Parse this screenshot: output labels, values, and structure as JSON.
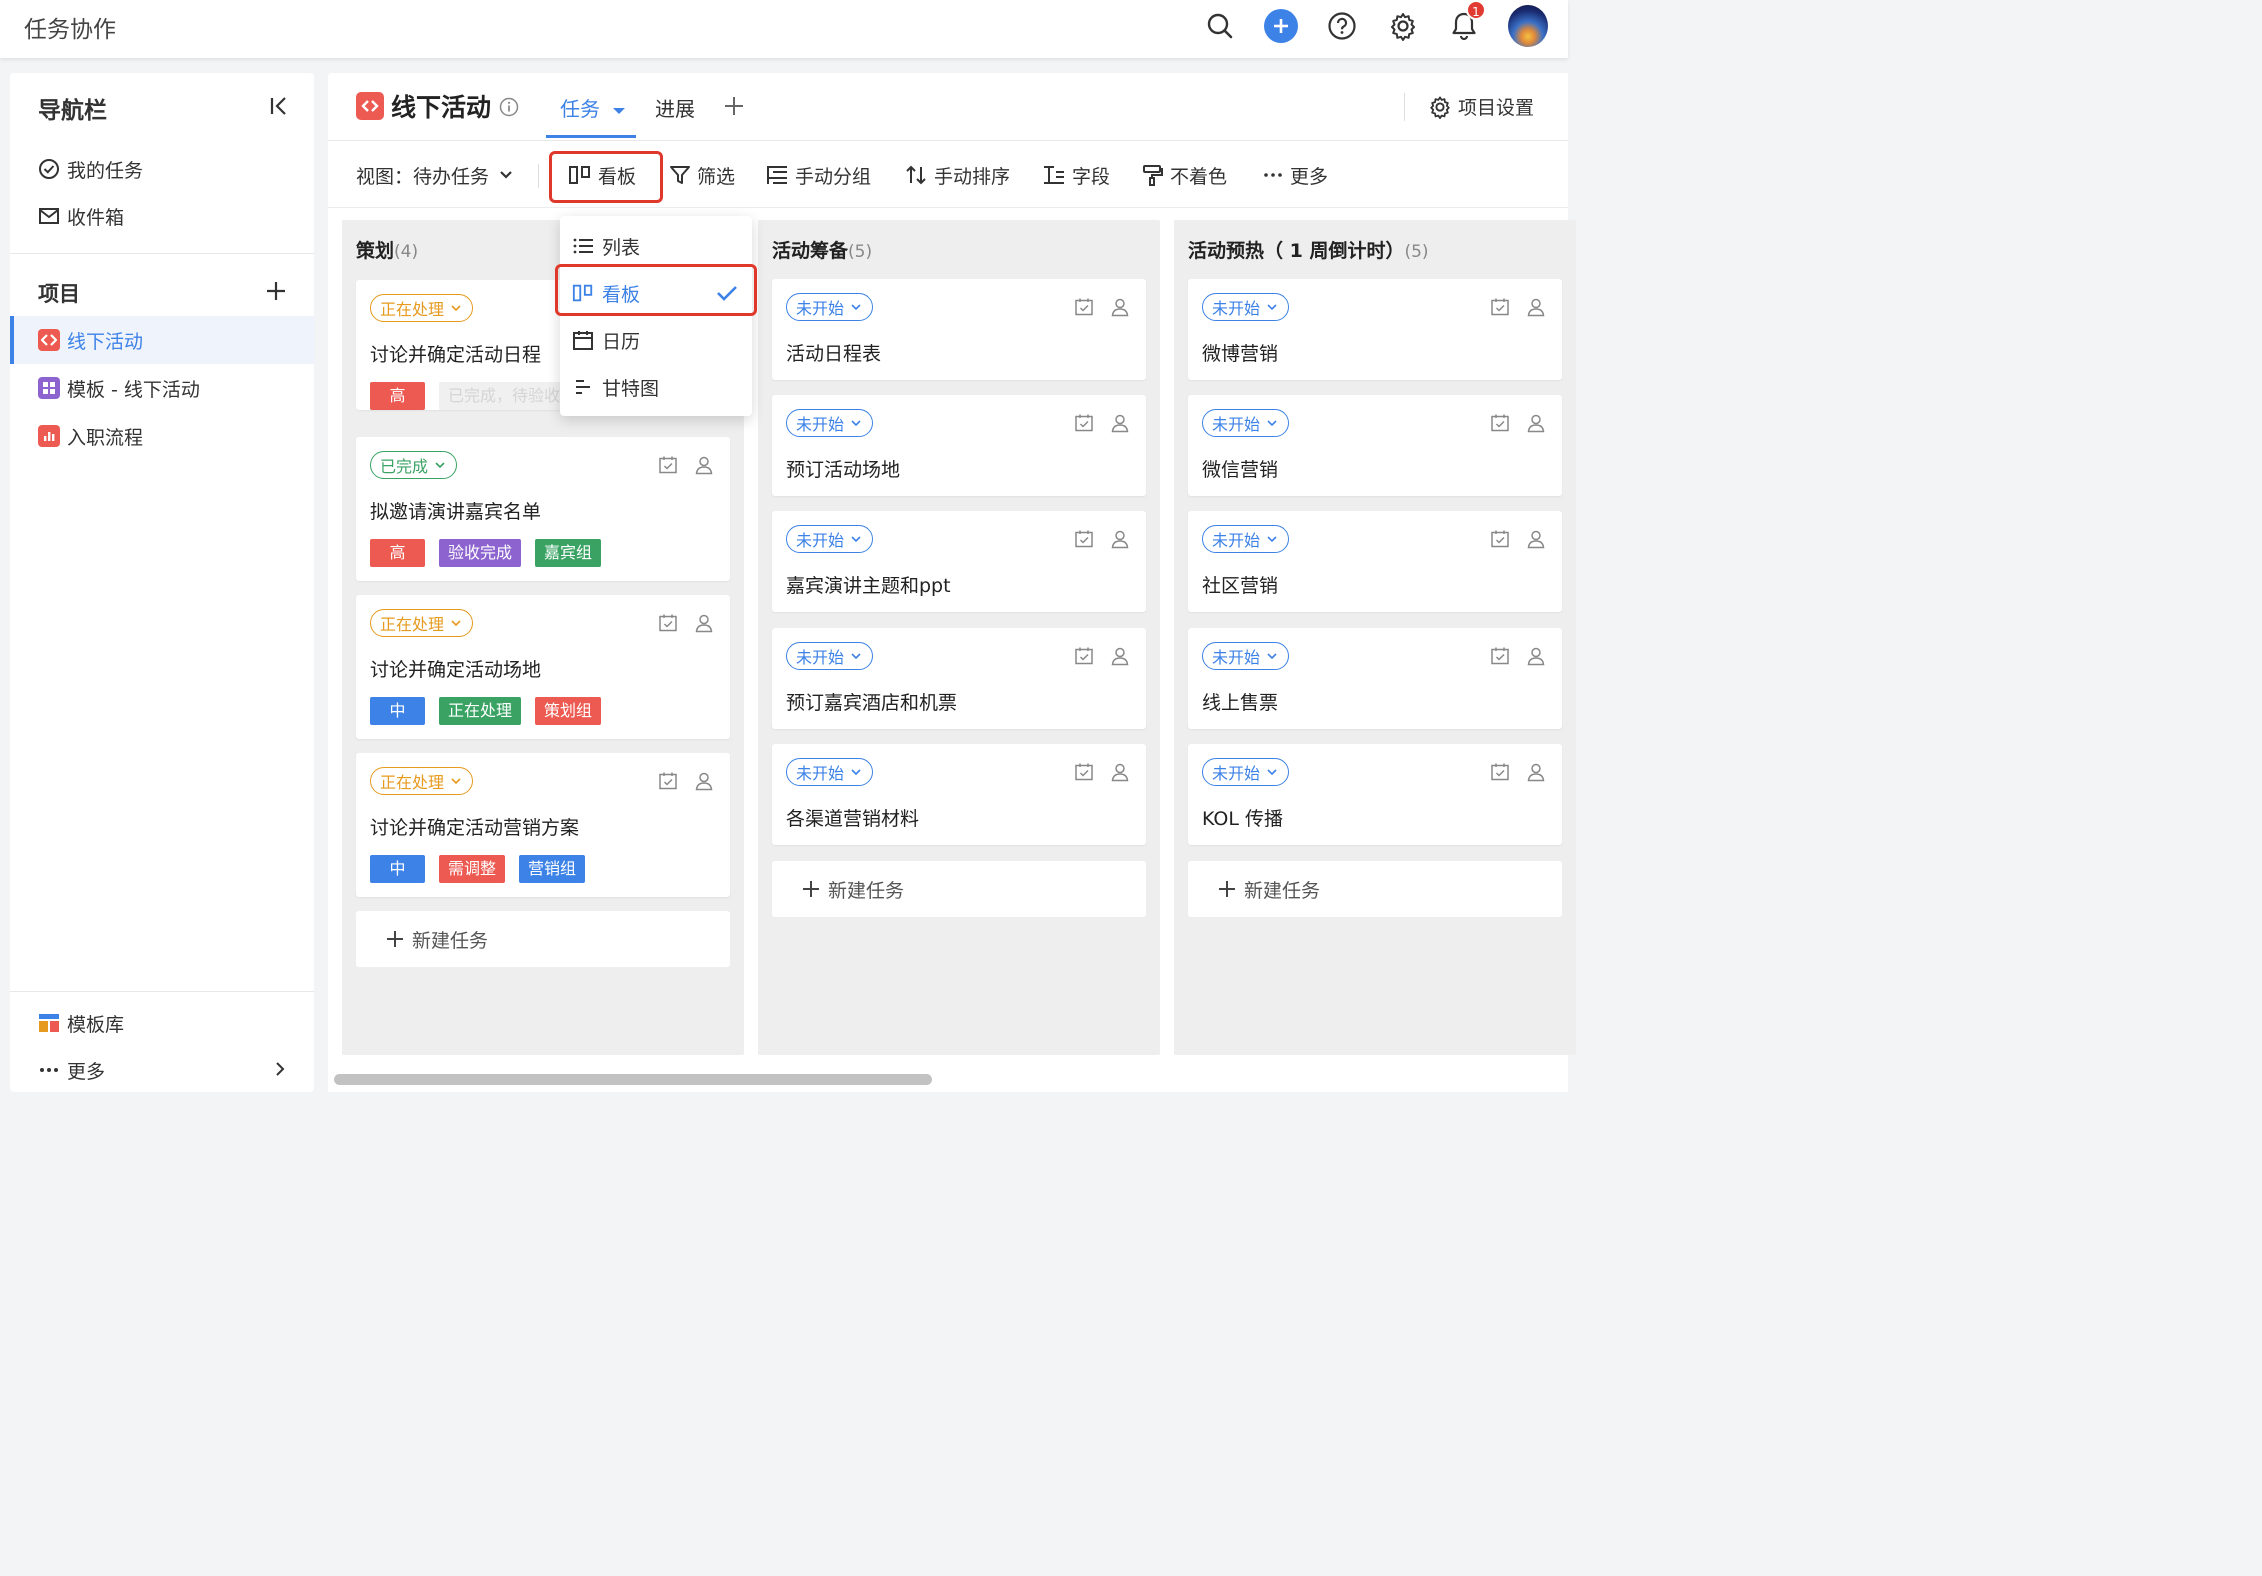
{
  "app_title": "任务协作",
  "topbar": {
    "notification_count": "1",
    "icons": [
      "search-icon",
      "add-icon",
      "help-icon",
      "settings-icon",
      "bell-icon",
      "avatar"
    ]
  },
  "sidebar": {
    "title": "导航栏",
    "items": [
      {
        "label": "我的任务",
        "icon": "check-circle-icon"
      },
      {
        "label": "收件箱",
        "icon": "mail-icon"
      }
    ],
    "projects_title": "项目",
    "projects": [
      {
        "label": "线下活动",
        "icon": "code-icon",
        "color": "#ec5a52",
        "active": true
      },
      {
        "label": "模板 - 线下活动",
        "icon": "template-icon",
        "color": "#8d63cf"
      },
      {
        "label": "入职流程",
        "icon": "chart-icon",
        "color": "#ec5a52"
      }
    ],
    "footer": [
      {
        "label": "模板库",
        "icon": "template-library-icon"
      },
      {
        "label": "更多",
        "icon": "more-icon"
      }
    ]
  },
  "project": {
    "title": "线下活动",
    "tabs": [
      {
        "label": "任务",
        "active": true
      },
      {
        "label": "进展"
      }
    ],
    "settings_label": "项目设置"
  },
  "toolbar": {
    "view_label": "视图：待办任务",
    "items": [
      "看板",
      "筛选",
      "手动分组",
      "手动排序",
      "字段",
      "不着色",
      "更多"
    ]
  },
  "view_dropdown": {
    "items": [
      "列表",
      "看板",
      "日历",
      "甘特图"
    ],
    "selected": "看板"
  },
  "board": {
    "new_task_label": "新建任务",
    "columns": [
      {
        "title": "策划",
        "count": "(4)",
        "cards": [
          {
            "status": "正在处理",
            "title": "讨论并确定活动日程",
            "tags": [
              "高",
              "已完成，待验收"
            ]
          },
          {
            "status": "已完成",
            "title": "拟邀请演讲嘉宾名单",
            "tags": [
              "高",
              "验收完成",
              "嘉宾组"
            ]
          },
          {
            "status": "正在处理",
            "title": "讨论并确定活动场地",
            "tags": [
              "中",
              "正在处理",
              "策划组"
            ]
          },
          {
            "status": "正在处理",
            "title": "讨论并确定活动营销方案",
            "tags": [
              "中",
              "需调整",
              "营销组"
            ]
          }
        ]
      },
      {
        "title": "活动筹备",
        "count": "(5)",
        "cards": [
          {
            "status": "未开始",
            "title": "活动日程表"
          },
          {
            "status": "未开始",
            "title": "预订活动场地"
          },
          {
            "status": "未开始",
            "title": "嘉宾演讲主题和ppt"
          },
          {
            "status": "未开始",
            "title": "预订嘉宾酒店和机票"
          },
          {
            "status": "未开始",
            "title": "各渠道营销材料"
          }
        ]
      },
      {
        "title": "活动预热（ 1 周倒计时）",
        "count": "(5)",
        "cards": [
          {
            "status": "未开始",
            "title": "微博营销"
          },
          {
            "status": "未开始",
            "title": "微信营销"
          },
          {
            "status": "未开始",
            "title": "社区营销"
          },
          {
            "status": "未开始",
            "title": "线上售票"
          },
          {
            "status": "未开始",
            "title": "KOL 传播"
          }
        ]
      }
    ]
  },
  "colors": {
    "accent": "#3d82e6",
    "red": "#ec5a52",
    "orange": "#e69a1f",
    "green": "#3aa364",
    "purple": "#8d63cf",
    "highlight": "#e0372b"
  }
}
